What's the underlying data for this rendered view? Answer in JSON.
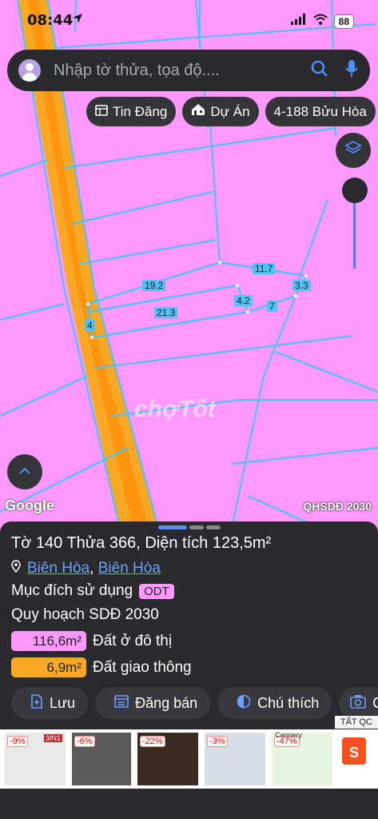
{
  "status": {
    "time": "08:44",
    "battery": "88"
  },
  "search": {
    "placeholder": "Nhập tờ thửa, tọa độ...."
  },
  "chips": [
    {
      "label": "Tin Đăng",
      "icon": "listing-icon"
    },
    {
      "label": "Dự Án",
      "icon": "building-icon"
    },
    {
      "label": "4-188 Bửu Hòa"
    }
  ],
  "map": {
    "parcel_labels": [
      "11.7",
      "19.2",
      "3.3",
      "4.2",
      "7",
      "21.3",
      "4"
    ],
    "watermark": "chợTốt",
    "google_label": "Google",
    "layer_badge": "QHSDĐ 2030"
  },
  "panel": {
    "title": "Tờ 140 Thửa 366, Diện tích 123,5m²",
    "location_1": "Biên Hòa",
    "location_sep": ",",
    "location_2": "Biên Hòa",
    "purpose_label": "Mục đích sử dụng",
    "purpose_code": "ODT",
    "plan": "Quy hoạch SDĐ 2030",
    "areas": [
      {
        "value": "116,6m²",
        "label": "Đất ở đô thị",
        "color": "#ff99ff"
      },
      {
        "value": "6,9m²",
        "label": "Đất giao thông",
        "color": "#f9a825"
      }
    ]
  },
  "actions": [
    {
      "label": "Lưu",
      "icon": "save-icon"
    },
    {
      "label": "Đăng bán",
      "icon": "post-icon"
    },
    {
      "label": "Chú thích",
      "icon": "legend-icon"
    },
    {
      "label": "C",
      "icon": "camera-icon"
    }
  ],
  "ads": {
    "label": "TẤT QC",
    "items": [
      "-9%",
      "-6%",
      "-22%",
      "-3%",
      "-47%"
    ],
    "tag_1": "3IN1",
    "tag_2": "Cannery"
  },
  "colors": {
    "land": "#ff99ff",
    "road": "#f9a825",
    "boundary": "#4fc3f7"
  }
}
